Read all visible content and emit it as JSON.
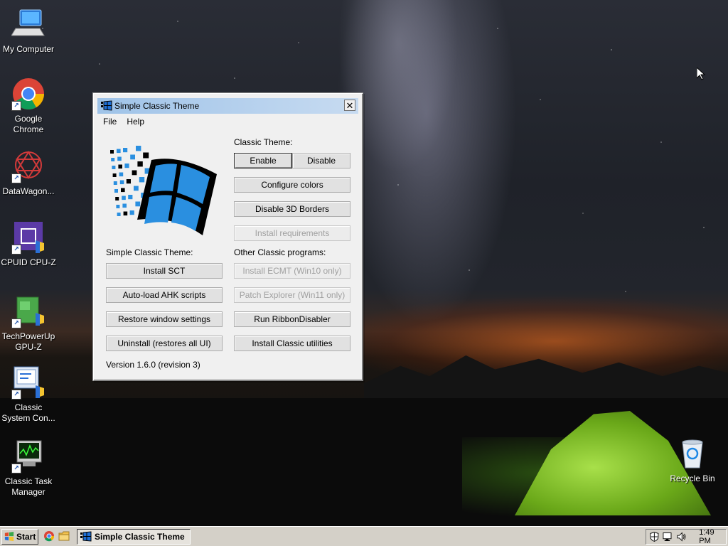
{
  "desktop": {
    "icons": [
      {
        "label": "My Computer",
        "icon": "computer-icon"
      },
      {
        "label": "Google Chrome",
        "icon": "chrome-icon"
      },
      {
        "label": "DataWagon...",
        "icon": "datawagon-icon"
      },
      {
        "label": "CPUID CPU-Z",
        "icon": "cpuz-icon"
      },
      {
        "label": "TechPowerUp GPU-Z",
        "icon": "gpuz-icon"
      },
      {
        "label": "Classic System Con...",
        "icon": "control-panel-icon"
      },
      {
        "label": "Classic Task Manager",
        "icon": "task-manager-icon"
      },
      {
        "label": "Recycle Bin",
        "icon": "recycle-bin-icon"
      }
    ]
  },
  "window": {
    "title": "Simple Classic Theme",
    "close_glyph": "✕",
    "menu": [
      "File",
      "Help"
    ],
    "classic_theme_label": "Classic Theme:",
    "enable_label": "Enable",
    "disable_label": "Disable",
    "configure_colors_label": "Configure colors",
    "disable_3d_borders_label": "Disable 3D Borders",
    "install_requirements_label": "Install requirements",
    "sct_label": "Simple Classic Theme:",
    "install_sct_label": "Install SCT",
    "autoload_ahk_label": "Auto-load AHK scripts",
    "restore_window_label": "Restore window settings",
    "uninstall_label": "Uninstall (restores all UI)",
    "other_programs_label": "Other Classic programs:",
    "install_ecmt_label": "Install ECMT (Win10 only)",
    "patch_explorer_label": "Patch Explorer (Win11 only)",
    "run_ribbon_label": "Run RibbonDisabler",
    "install_utilities_label": "Install Classic utilities",
    "version": "Version 1.6.0 (revision 3)"
  },
  "taskbar": {
    "start_label": "Start",
    "task_title": "Simple Classic Theme",
    "clock": "1:49 PM"
  },
  "colors": {
    "titlebar_start": "#9fc3e8",
    "titlebar_end": "#c7dbf1",
    "window_bg": "#f0f0f0",
    "taskbar_bg": "#d4d0c8"
  }
}
